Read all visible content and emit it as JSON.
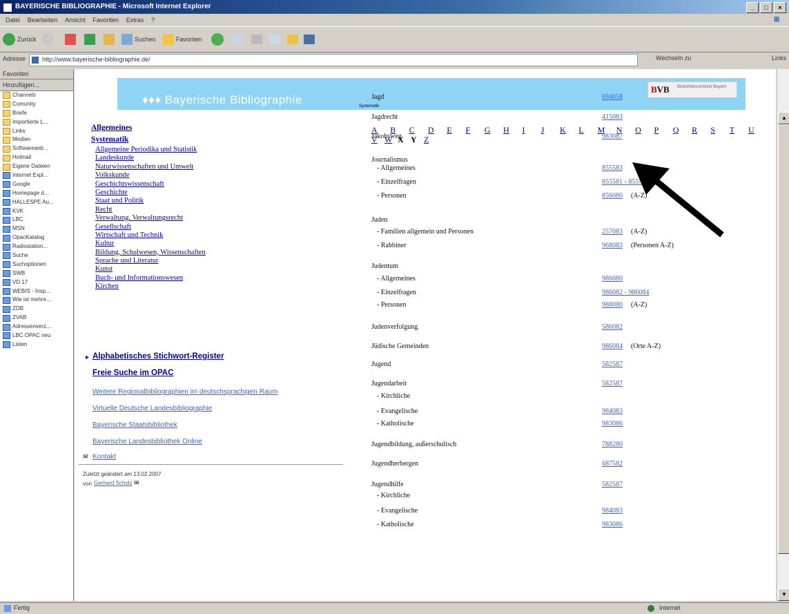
{
  "window": {
    "title": "BAYERISCHE BIBLIOGRAPHIE - Microsoft Internet Explorer"
  },
  "menu": [
    "Datei",
    "Bearbeiten",
    "Ansicht",
    "Favoriten",
    "Extras",
    "?"
  ],
  "toolbar": {
    "back": "Zurück",
    "search": "Suchen",
    "favorites": "Favoriten"
  },
  "address": {
    "label": "Adresse",
    "url": "http://www.bayerische-bibliographie.de/",
    "go": "Wechseln zu",
    "links": "Links"
  },
  "sidebar": {
    "title": "Favoriten",
    "add": "Hinzufügen...",
    "items": [
      "Channels",
      "Comunity",
      "Briefe",
      "Importierte L...",
      "Links",
      "Medien",
      "Softwareanb...",
      "Hotmail",
      "Eigene Dateien",
      "Internet Expl...",
      "Google",
      "Homepage d...",
      "HALLESPE Au...",
      "KVK",
      "LBC",
      "MSN",
      "OpacKatalog",
      "Radiostation...",
      "Suche",
      "Suchoptionen",
      "SWB",
      "VD 17",
      "WEBIS - Insp...",
      "Wie ist mehre...",
      "ZDB",
      "ZVAB",
      "Adressenverz...",
      "LBC OPAC neu",
      "Listen"
    ]
  },
  "banner": {
    "title": "♦♦♦  Bayerische Bibliographie",
    "sub": "Systematik",
    "bvb_text": "Bibliotheksverbund Bayern"
  },
  "left": {
    "allgemeines": "Allgemeines",
    "systematik": "Systematik",
    "sections": [
      "Allgemeine Periodika und Statistik",
      "Landeskunde",
      "Naturwissenschaften und Umwelt",
      "Volkskunde",
      "Geschichtswissenschaft",
      "Geschichte",
      "Staat und Politik",
      "Recht",
      "Verwaltung, Verwaltungsrecht",
      "Gesellschaft",
      "Wirtschaft und Technik",
      "Kultur",
      "Bildung, Schulwesen, Wissenschaften",
      "Sprache und Literatur",
      "Kunst",
      "Buch- und Informationswesen",
      "Kirchen"
    ],
    "register": "Alphabetisches Stichwort-Register",
    "opac": "Freie Suche im OPAC",
    "ext": [
      "Weitere Regionalbibliographien im deutschsprachigen Raum",
      "Virtuelle Deutsche Landesbibliographie",
      "Bayerische Staatsbibliothek",
      "Bayerische Landesbibliothek Online"
    ],
    "contact": "Kontakt",
    "updated": "Zuletzt geändert am 13.02.2007",
    "by": "von",
    "author": "Gerhard Scholz"
  },
  "letters": [
    "A",
    "B",
    "C",
    "D",
    "E",
    "F",
    "G",
    "H",
    "I",
    "J",
    "K",
    "L",
    "M",
    "N",
    "O",
    "P",
    "Q",
    "R",
    "S",
    "T",
    "U",
    "V",
    "W",
    "X",
    "Y",
    "Z"
  ],
  "index": [
    {
      "term": "Jagd",
      "code": "694058",
      "note": ""
    },
    {
      "term": "Jagdrecht",
      "code": "415083",
      "note": ""
    },
    {
      "term": "Jakobsweg",
      "code": "983087",
      "note": ""
    },
    {
      "term": "Journalismus",
      "code": "",
      "note": ""
    },
    {
      "term": "- Allgemeines",
      "code": "855583",
      "note": ""
    },
    {
      "term": "- Einzelfragen",
      "code": "855581 - 855585",
      "note": ""
    },
    {
      "term": "- Personen",
      "code": "856080",
      "note": "(A-Z)"
    },
    {
      "term": "Juden",
      "code": "",
      "note": ""
    },
    {
      "term": "- Familien allgemein und Personen",
      "code": "257083",
      "note": "(A-Z)"
    },
    {
      "term": "- Rabbiner",
      "code": "968083",
      "note": "(Personen A-Z)"
    },
    {
      "term": "Judentum",
      "code": "",
      "note": ""
    },
    {
      "term": "- Allgemeines",
      "code": "986080",
      "note": ""
    },
    {
      "term": "- Einzelfragen",
      "code": "986082 - 986084",
      "note": ""
    },
    {
      "term": "- Personen",
      "code": "988080",
      "note": "(A-Z)"
    },
    {
      "term": "Judenverfolgung",
      "code": "586082",
      "note": ""
    },
    {
      "term": "Jüdische Gemeinden",
      "code": "986084",
      "note": "(Orte A-Z)"
    },
    {
      "term": "Jugend",
      "code": "582587",
      "note": ""
    },
    {
      "term": "Jugendarbeit",
      "code": "582587",
      "note": ""
    },
    {
      "term": "- Kirchliche",
      "code": "",
      "note": ""
    },
    {
      "term": "- Evangelische",
      "code": "984083",
      "note": ""
    },
    {
      "term": "- Katholische",
      "code": "983086",
      "note": ""
    },
    {
      "term": "Jugendbildung, außerschulisch",
      "code": "788280",
      "note": ""
    },
    {
      "term": "Jugendherbergen",
      "code": "687582",
      "note": ""
    },
    {
      "term": "Jugendhilfe",
      "code": "582587",
      "note": ""
    },
    {
      "term": "- Kirchliche",
      "code": "",
      "note": ""
    },
    {
      "term": "- Evangelische",
      "code": "984083",
      "note": ""
    },
    {
      "term": "- Katholische",
      "code": "983086",
      "note": ""
    }
  ],
  "status": {
    "text": "Fertig",
    "zone": "Internet"
  }
}
